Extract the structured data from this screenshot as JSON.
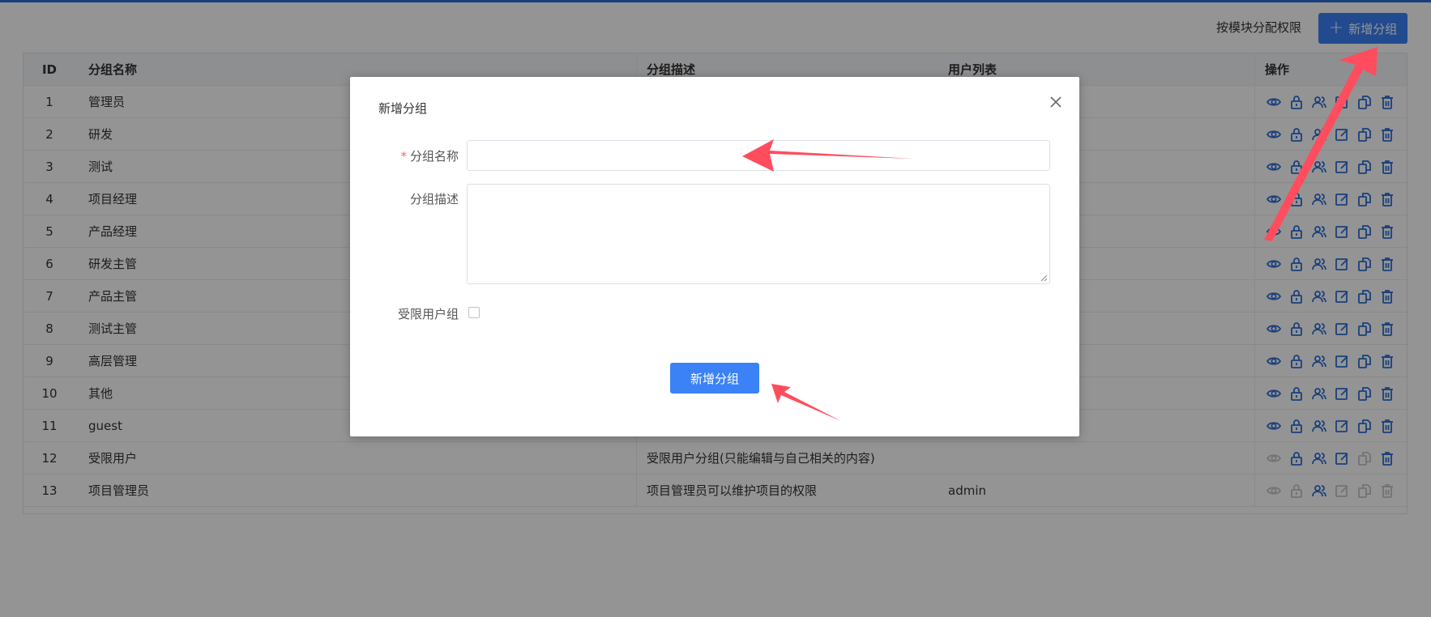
{
  "header": {
    "assign_by_module_label": "按模块分配权限",
    "add_group_label": "新增分组"
  },
  "table": {
    "columns": [
      "ID",
      "分组名称",
      "分组描述",
      "用户列表",
      "操作"
    ],
    "rows": [
      {
        "id": "1",
        "name": "管理员",
        "desc": "",
        "users": "",
        "disabled_ops": []
      },
      {
        "id": "2",
        "name": "研发",
        "desc": "",
        "users": "",
        "disabled_ops": []
      },
      {
        "id": "3",
        "name": "测试",
        "desc": "",
        "users": "",
        "disabled_ops": []
      },
      {
        "id": "4",
        "name": "项目经理",
        "desc": "",
        "users": "",
        "disabled_ops": []
      },
      {
        "id": "5",
        "name": "产品经理",
        "desc": "",
        "users": "",
        "disabled_ops": []
      },
      {
        "id": "6",
        "name": "研发主管",
        "desc": "",
        "users": "",
        "disabled_ops": []
      },
      {
        "id": "7",
        "name": "产品主管",
        "desc": "",
        "users": "",
        "disabled_ops": []
      },
      {
        "id": "8",
        "name": "测试主管",
        "desc": "",
        "users": "",
        "disabled_ops": []
      },
      {
        "id": "9",
        "name": "高层管理",
        "desc": "",
        "users": "",
        "disabled_ops": []
      },
      {
        "id": "10",
        "name": "其他",
        "desc": "",
        "users": "",
        "disabled_ops": []
      },
      {
        "id": "11",
        "name": "guest",
        "desc": "",
        "users": "",
        "disabled_ops": []
      },
      {
        "id": "12",
        "name": "受限用户",
        "desc": "受限用户分组(只能编辑与自己相关的内容)",
        "users": "",
        "disabled_ops": [
          "view",
          "copy"
        ]
      },
      {
        "id": "13",
        "name": "项目管理员",
        "desc": "项目管理员可以维护项目的权限",
        "users": "admin",
        "disabled_ops": [
          "view",
          "lock",
          "edit",
          "copy",
          "delete"
        ]
      }
    ],
    "op_icons": [
      "eye-icon",
      "lock-icon",
      "users-icon",
      "edit-icon",
      "copy-icon",
      "trash-icon"
    ],
    "accent_color": "#2b6fd6",
    "disabled_color": "#c7c7c7"
  },
  "modal": {
    "title": "新增分组",
    "name_label": "分组名称",
    "required_mark": "*",
    "name_value": "",
    "desc_label": "分组描述",
    "desc_value": "",
    "limited_label": "受限用户组",
    "limited_checked": false,
    "submit_label": "新增分组"
  },
  "annotations": {
    "arrow_color": "#ff4d5e"
  }
}
